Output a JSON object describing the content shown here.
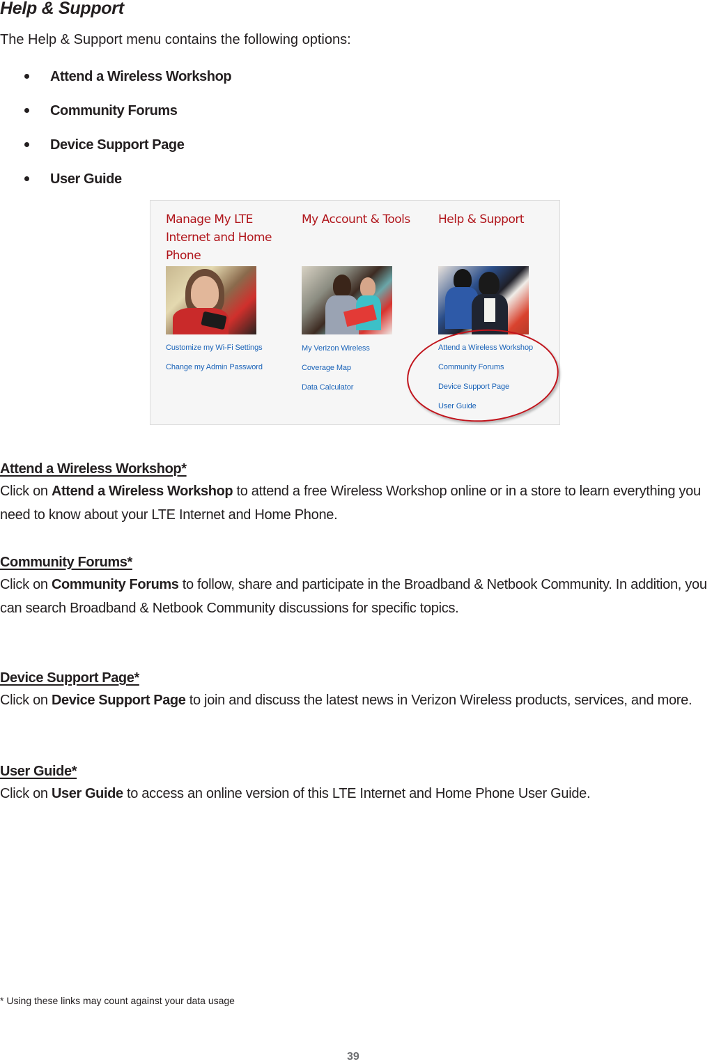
{
  "page": {
    "title": "Help & Support",
    "intro": "The Help & Support menu contains the following options:",
    "bullets": [
      "Attend a Wireless Workshop",
      "Community Forums",
      "Device Support Page",
      "User Guide"
    ],
    "page_number": "39",
    "footnote": "* Using these links may count against your data usage"
  },
  "screenshot": {
    "accent_title_color": "#b0151b",
    "link_color": "#1a63b8",
    "highlight_color": "#c1141c",
    "columns": [
      {
        "title": "Manage My LTE Internet and Home Phone",
        "image": "woman-smiling-with-phone-photo",
        "links": [
          "Customize my Wi-Fi Settings",
          "Change my Admin Password"
        ]
      },
      {
        "title": "My Account & Tools",
        "image": "two-people-with-red-tablet-photo",
        "links": [
          "My Verizon Wireless",
          "Coverage Map",
          "Data Calculator"
        ]
      },
      {
        "title": "Help & Support",
        "image": "two-people-using-tablet-photo",
        "links": [
          "Attend a Wireless Workshop",
          "Community Forums",
          "Device Support Page",
          "User Guide"
        ]
      }
    ]
  },
  "sections": [
    {
      "heading": "Attend a Wireless Workshop*",
      "prefix": "Click on ",
      "bold": "Attend a Wireless Workshop",
      "text": " to attend a free Wireless Workshop online or in a store to learn everything you need to know about your LTE Internet and Home Phone."
    },
    {
      "heading": "Community Forums*",
      "prefix": "Click on ",
      "bold": "Community Forums",
      "text": " to follow, share and participate in the Broadband & Netbook Community. In addition, you can search Broadband & Netbook Community discussions for specific topics."
    },
    {
      "heading": "Device Support Page*",
      "prefix": "Click on ",
      "bold": "Device Support Page",
      "text": " to join and discuss the latest news in Verizon Wireless products, services, and more."
    },
    {
      "heading": "User Guide*",
      "prefix": "Click on ",
      "bold": "User Guide",
      "text": " to access an online version of this LTE Internet and Home Phone User Guide."
    }
  ]
}
